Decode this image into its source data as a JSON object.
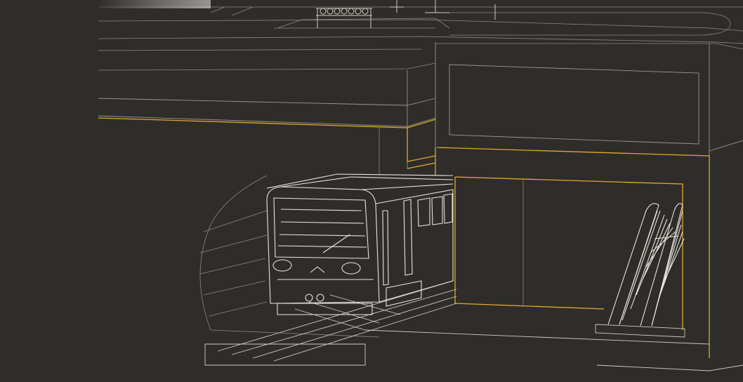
{
  "scene": {
    "background_color": "#2f2d2a",
    "line_color": "#cfcac2",
    "accent_color": "#e0a92a",
    "icons": [
      "train-icon",
      "escalator-icon",
      "tunnel-icon",
      "platform-icon",
      "street-railing-icon"
    ]
  }
}
